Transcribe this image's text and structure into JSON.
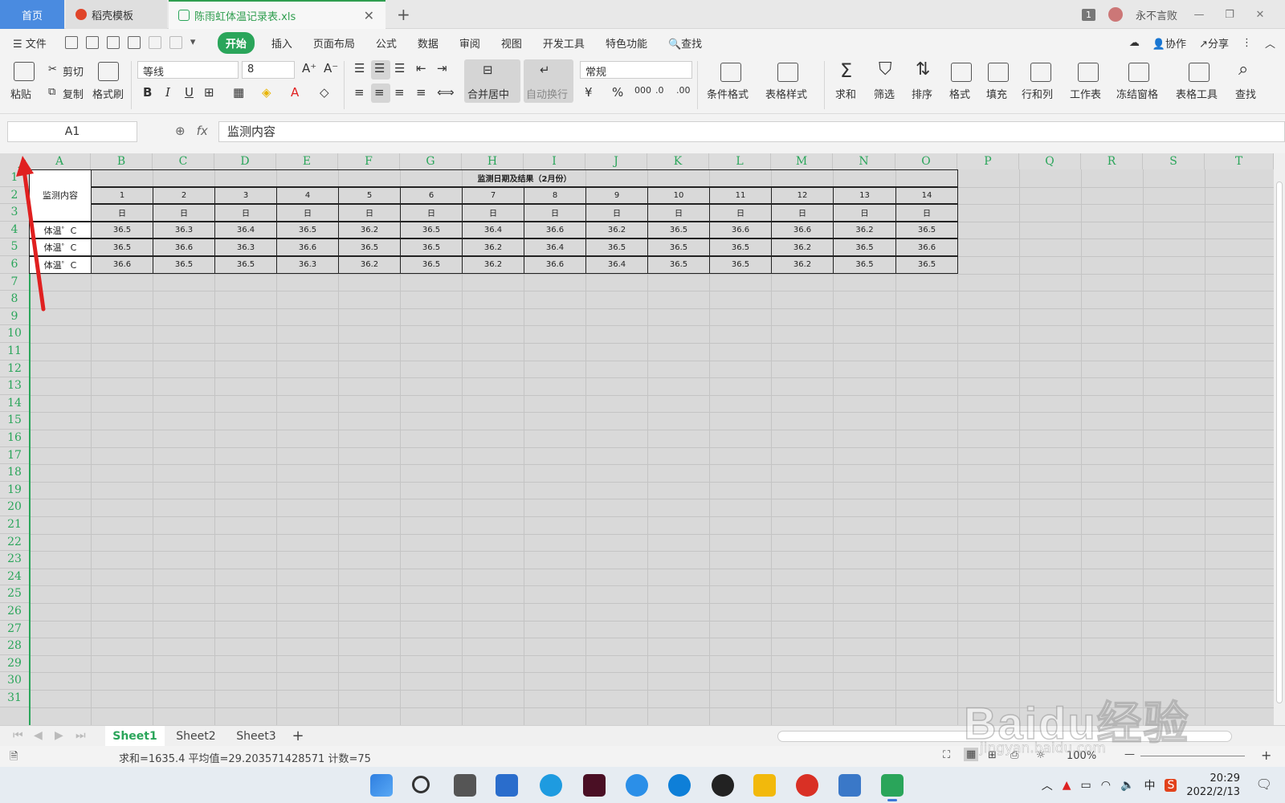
{
  "tabs": {
    "home": "首页",
    "template": "稻壳模板",
    "file": "陈雨虹体温记录表.xls"
  },
  "titlebar": {
    "page_count": "1",
    "username": "永不言败"
  },
  "menu": {
    "file": "文件",
    "items": [
      "开始",
      "插入",
      "页面布局",
      "公式",
      "数据",
      "审阅",
      "视图",
      "开发工具",
      "特色功能"
    ],
    "search": "查找",
    "collab": "协作",
    "share": "分享"
  },
  "ribbon": {
    "paste": "粘贴",
    "cut": "剪切",
    "copy": "复制",
    "format_painter": "格式刷",
    "font_name": "等线",
    "font_size": "8",
    "bold": "B",
    "italic": "I",
    "underline": "U",
    "merge_center": "合并居中",
    "wrap_text": "自动换行",
    "number_format": "常规",
    "conditional_format": "条件格式",
    "table_style": "表格样式",
    "sum": "求和",
    "filter": "筛选",
    "sort": "排序",
    "format": "格式",
    "fill": "填充",
    "row_col": "行和列",
    "worksheet": "工作表",
    "freeze": "冻结窗格",
    "table_tools": "表格工具",
    "find": "查找"
  },
  "formula_bar": {
    "cell_ref": "A1",
    "fx": "fx",
    "content": "监测内容"
  },
  "grid": {
    "columns": [
      "A",
      "B",
      "C",
      "D",
      "E",
      "F",
      "G",
      "H",
      "I",
      "J",
      "K",
      "L",
      "M",
      "N",
      "O",
      "P",
      "Q",
      "R",
      "S",
      "T"
    ],
    "rows": [
      "1",
      "2",
      "3",
      "4",
      "5",
      "6",
      "7",
      "8",
      "9",
      "10",
      "11",
      "12",
      "13",
      "14",
      "15",
      "16",
      "17",
      "18",
      "19",
      "20",
      "21",
      "22",
      "23",
      "24",
      "25",
      "26",
      "27",
      "28",
      "29",
      "30",
      "31"
    ]
  },
  "table": {
    "header_a": "监测内容",
    "header_title": "监测日期及结果（2月份）",
    "days": [
      "1",
      "2",
      "3",
      "4",
      "5",
      "6",
      "7",
      "8",
      "9",
      "10",
      "11",
      "12",
      "13",
      "14"
    ],
    "day_unit": "日",
    "row_label": "体温゜C",
    "values": [
      [
        "36.5",
        "36.3",
        "36.4",
        "36.5",
        "36.2",
        "36.5",
        "36.4",
        "36.6",
        "36.2",
        "36.5",
        "36.6",
        "36.6",
        "36.2",
        "36.5"
      ],
      [
        "36.5",
        "36.6",
        "36.3",
        "36.6",
        "36.5",
        "36.5",
        "36.2",
        "36.4",
        "36.5",
        "36.5",
        "36.5",
        "36.2",
        "36.5",
        "36.6"
      ],
      [
        "36.6",
        "36.5",
        "36.5",
        "36.3",
        "36.2",
        "36.5",
        "36.2",
        "36.6",
        "36.4",
        "36.5",
        "36.5",
        "36.2",
        "36.5",
        "36.5"
      ]
    ]
  },
  "sheets": [
    "Sheet1",
    "Sheet2",
    "Sheet3"
  ],
  "status": {
    "summary": "求和=1635.4  平均值=29.203571428571  计数=75",
    "zoom": "100%"
  },
  "taskbar": {
    "ime": "中",
    "time": "20:29",
    "date": "2022/2/13"
  },
  "watermark": {
    "text": "Baidu经验",
    "url": "jingyan.baidu.com"
  },
  "colors": {
    "accent_green": "#2aa55a",
    "tab_blue": "#4a8be0",
    "annotation_red": "#e02020"
  }
}
